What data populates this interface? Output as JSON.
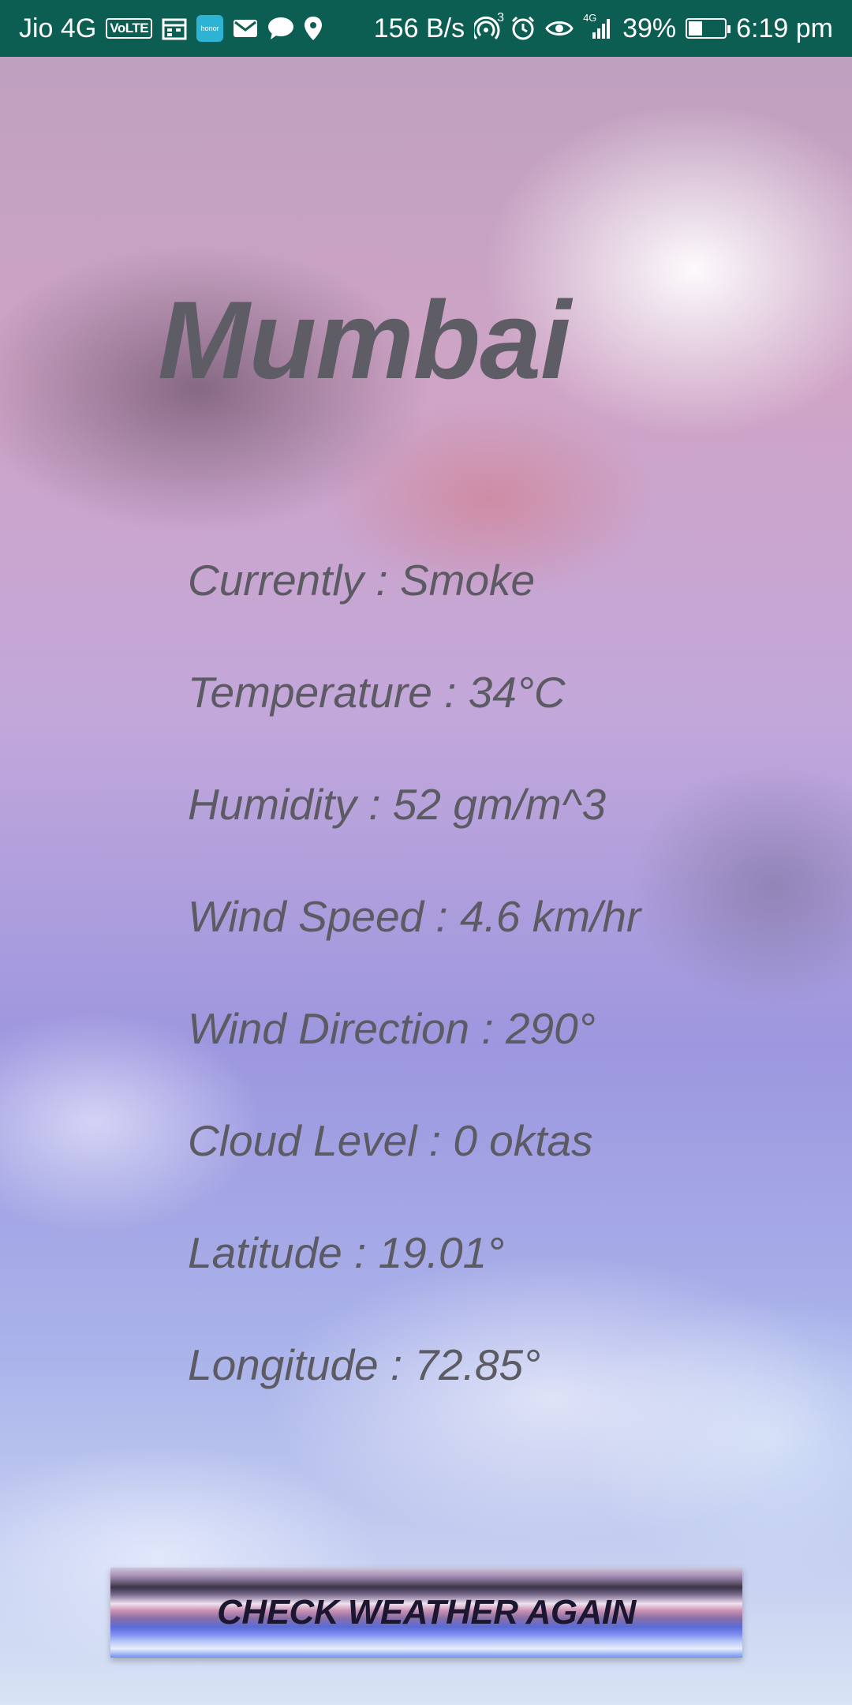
{
  "status_bar": {
    "carrier": "Jio 4G",
    "volte": "VoLTE",
    "honor_label": "honor",
    "network_speed": "156 B/s",
    "hotspot_count": "3",
    "network_type": "4G",
    "battery_percent": "39%",
    "battery_level": 0.39,
    "time": "6:19 pm"
  },
  "city": "Mumbai",
  "weather": [
    {
      "label": "Currently",
      "value": "Smoke"
    },
    {
      "label": "Temperature",
      "value": "34°C"
    },
    {
      "label": "Humidity",
      "value": "52 gm/m^3"
    },
    {
      "label": "Wind Speed",
      "value": "4.6 km/hr"
    },
    {
      "label": "Wind Direction",
      "value": "290°"
    },
    {
      "label": "Cloud Level",
      "value": "0 oktas"
    },
    {
      "label": "Latitude",
      "value": "19.01°"
    },
    {
      "label": "Longitude",
      "value": "72.85°"
    }
  ],
  "separator": " : ",
  "button": {
    "label": "CHECK WEATHER AGAIN"
  },
  "colors": {
    "status_bar": "#0d5e52",
    "text": "#5c5a63",
    "button_text": "#1b1730"
  },
  "icons": [
    "calendar-icon",
    "mail-icon",
    "chat-icon",
    "location-icon",
    "hotspot-icon",
    "alarm-icon",
    "eye-icon",
    "signal-icon",
    "battery-charging-icon"
  ]
}
